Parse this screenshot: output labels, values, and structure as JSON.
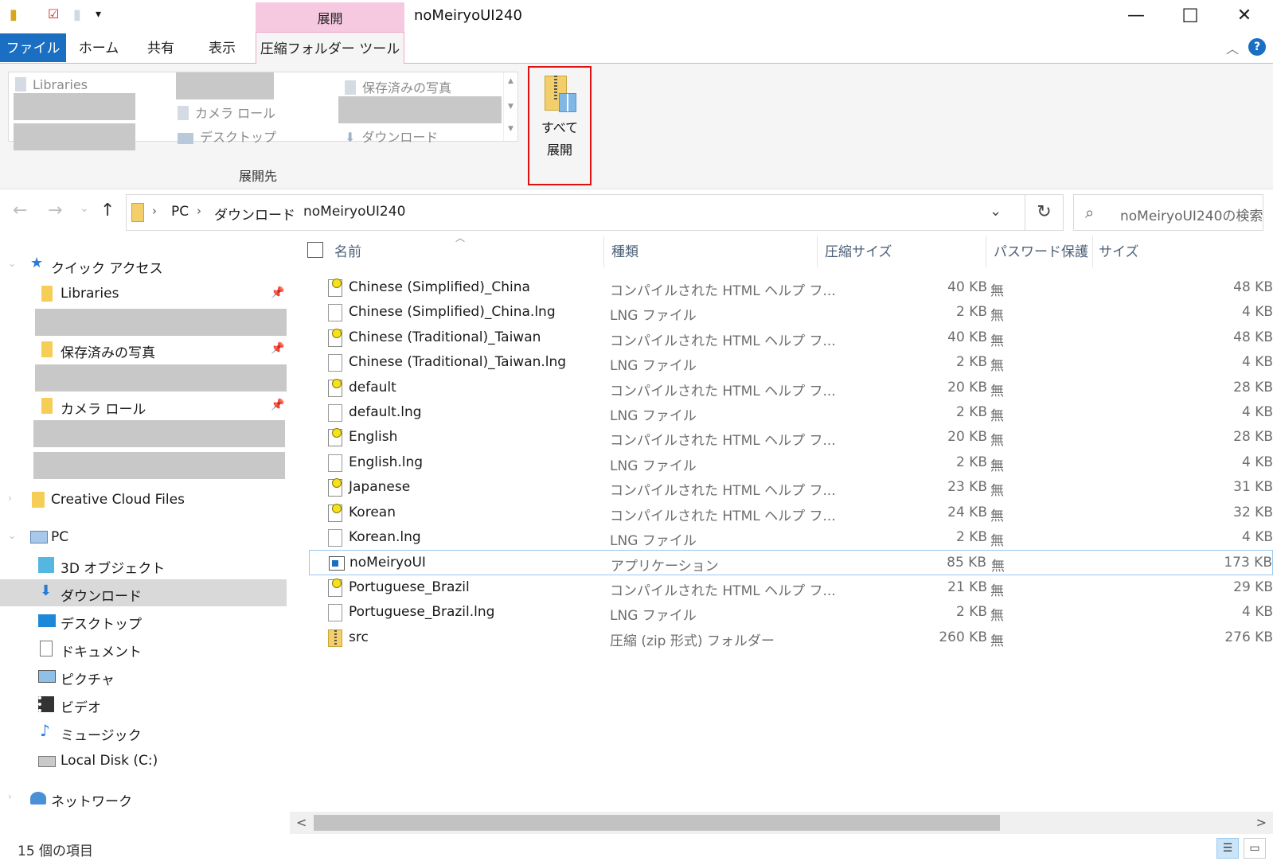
{
  "window": {
    "title": "noMeiryoUI240",
    "context_tab_header": "展開",
    "minimize": "—",
    "maximize": "☐",
    "close": "✕"
  },
  "quick_access_toolbar": {
    "dropdown": "▾"
  },
  "ribbon_tabs": [
    {
      "label": "ファイル"
    },
    {
      "label": "ホーム"
    },
    {
      "label": "共有"
    },
    {
      "label": "表示"
    },
    {
      "label": "圧縮フォルダー ツール"
    }
  ],
  "ribbon_right": {
    "collapse": "︿",
    "help": "?"
  },
  "ribbon": {
    "gallery_items": [
      {
        "label": "Libraries"
      },
      {
        "label": "カメラ ロール"
      },
      {
        "label": "デスクトップ"
      },
      {
        "label": "保存済みの写真"
      },
      {
        "label": "ダウンロード"
      }
    ],
    "group_label": "展開先",
    "extract_all_line1": "すべて",
    "extract_all_line2": "展開"
  },
  "navigation": {
    "back": "←",
    "forward": "→",
    "recent": "⌄",
    "up": "↑",
    "breadcrumb": [
      "PC",
      "ダウンロード",
      "noMeiryoUI240"
    ],
    "address_dropdown": "⌄",
    "refresh": "↻",
    "search_placeholder": "noMeiryoUI240の検索"
  },
  "nav_pane": {
    "quick_access": "クイック アクセス",
    "pinned": [
      "Libraries",
      "保存済みの写真",
      "カメラ ロール"
    ],
    "creative_cloud": "Creative Cloud Files",
    "pc": "PC",
    "pc_children": [
      "3D オブジェクト",
      "ダウンロード",
      "デスクトップ",
      "ドキュメント",
      "ピクチャ",
      "ビデオ",
      "ミュージック",
      "Local Disk (C:)"
    ],
    "network": "ネットワーク"
  },
  "columns": {
    "name": "名前",
    "type": "種類",
    "compressed_size": "圧縮サイズ",
    "password": "パスワード保護",
    "size": "サイズ"
  },
  "files": [
    {
      "name": "Chinese (Simplified)_China",
      "type": "コンパイルされた HTML ヘルプ フ...",
      "csize": "40 KB",
      "pw": "無",
      "size": "48 KB",
      "icon": "chm"
    },
    {
      "name": "Chinese (Simplified)_China.lng",
      "type": "LNG ファイル",
      "csize": "2 KB",
      "pw": "無",
      "size": "4 KB",
      "icon": "doc"
    },
    {
      "name": "Chinese (Traditional)_Taiwan",
      "type": "コンパイルされた HTML ヘルプ フ...",
      "csize": "40 KB",
      "pw": "無",
      "size": "48 KB",
      "icon": "chm"
    },
    {
      "name": "Chinese (Traditional)_Taiwan.lng",
      "type": "LNG ファイル",
      "csize": "2 KB",
      "pw": "無",
      "size": "4 KB",
      "icon": "doc"
    },
    {
      "name": "default",
      "type": "コンパイルされた HTML ヘルプ フ...",
      "csize": "20 KB",
      "pw": "無",
      "size": "28 KB",
      "icon": "chm"
    },
    {
      "name": "default.lng",
      "type": "LNG ファイル",
      "csize": "2 KB",
      "pw": "無",
      "size": "4 KB",
      "icon": "doc"
    },
    {
      "name": "English",
      "type": "コンパイルされた HTML ヘルプ フ...",
      "csize": "20 KB",
      "pw": "無",
      "size": "28 KB",
      "icon": "chm"
    },
    {
      "name": "English.lng",
      "type": "LNG ファイル",
      "csize": "2 KB",
      "pw": "無",
      "size": "4 KB",
      "icon": "doc"
    },
    {
      "name": "Japanese",
      "type": "コンパイルされた HTML ヘルプ フ...",
      "csize": "23 KB",
      "pw": "無",
      "size": "31 KB",
      "icon": "chm"
    },
    {
      "name": "Korean",
      "type": "コンパイルされた HTML ヘルプ フ...",
      "csize": "24 KB",
      "pw": "無",
      "size": "32 KB",
      "icon": "chm"
    },
    {
      "name": "Korean.lng",
      "type": "LNG ファイル",
      "csize": "2 KB",
      "pw": "無",
      "size": "4 KB",
      "icon": "doc"
    },
    {
      "name": "noMeiryoUI",
      "type": "アプリケーション",
      "csize": "85 KB",
      "pw": "無",
      "size": "173 KB",
      "icon": "app"
    },
    {
      "name": "Portuguese_Brazil",
      "type": "コンパイルされた HTML ヘルプ フ...",
      "csize": "21 KB",
      "pw": "無",
      "size": "29 KB",
      "icon": "chm"
    },
    {
      "name": "Portuguese_Brazil.lng",
      "type": "LNG ファイル",
      "csize": "2 KB",
      "pw": "無",
      "size": "4 KB",
      "icon": "doc"
    },
    {
      "name": "src",
      "type": "圧縮 (zip 形式) フォルダー",
      "csize": "260 KB",
      "pw": "無",
      "size": "276 KB",
      "icon": "zip"
    }
  ],
  "selected_file_index": 11,
  "status": {
    "item_count": "15 個の項目"
  },
  "scroll": {
    "left": "<",
    "right": ">"
  },
  "colors": {
    "accent": "#1a6fc2",
    "context_tab": "#f7c9e0",
    "highlight_border": "#e01010"
  }
}
